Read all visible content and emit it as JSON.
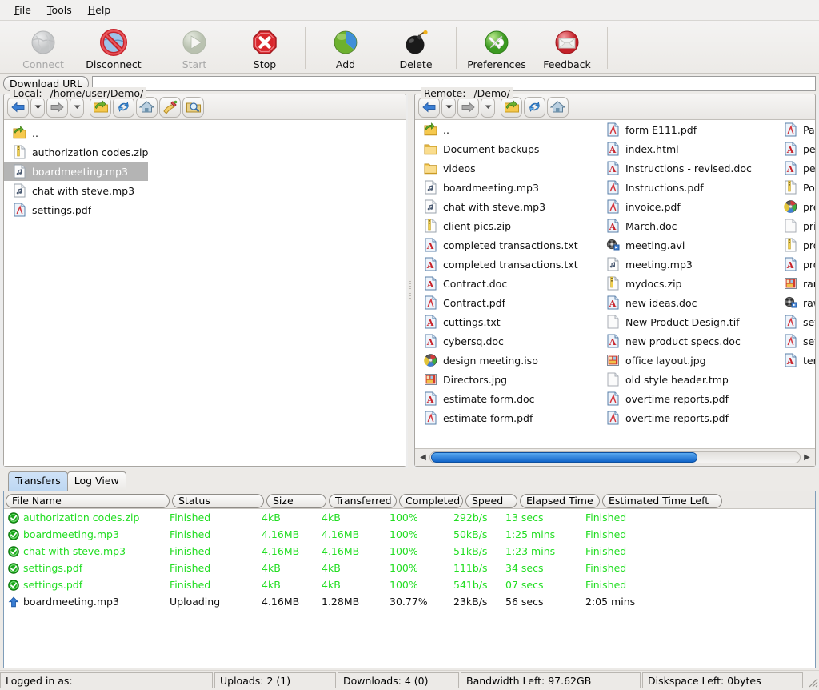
{
  "menubar": {
    "items": [
      {
        "label": "File",
        "mnemonic": "F"
      },
      {
        "label": "Tools",
        "mnemonic": "T"
      },
      {
        "label": "Help",
        "mnemonic": "H"
      }
    ]
  },
  "toolbar": {
    "buttons": [
      {
        "label": "Connect",
        "icon": "globe-icon",
        "enabled": false
      },
      {
        "label": "Disconnect",
        "icon": "no-entry-globe-icon",
        "enabled": true
      },
      {
        "label": "Start",
        "icon": "play-icon",
        "enabled": false
      },
      {
        "label": "Stop",
        "icon": "stop-octagon-icon",
        "enabled": true
      },
      {
        "label": "Add",
        "icon": "add-pie-icon",
        "enabled": true
      },
      {
        "label": "Delete",
        "icon": "bomb-icon",
        "enabled": true
      },
      {
        "label": "Preferences",
        "icon": "tools-gear-icon",
        "enabled": true
      },
      {
        "label": "Feedback",
        "icon": "envelope-icon",
        "enabled": true
      }
    ]
  },
  "download_url": {
    "button_label": "Download URL",
    "value": "",
    "placeholder": ""
  },
  "local_pane": {
    "legend_label": "Local:",
    "path": "/home/user/Demo/",
    "nav_buttons": [
      {
        "name": "back-button",
        "icon": "arrow-left-icon"
      },
      {
        "name": "back-history-button",
        "icon": "chevron-down-icon"
      },
      {
        "name": "forward-button",
        "icon": "arrow-right-icon"
      },
      {
        "name": "forward-history-button",
        "icon": "chevron-down-icon"
      },
      {
        "name": "up-directory-button",
        "icon": "folder-up-icon"
      },
      {
        "name": "refresh-button",
        "icon": "refresh-icon"
      },
      {
        "name": "home-button",
        "icon": "home-icon"
      },
      {
        "name": "cleanup-button",
        "icon": "broom-icon"
      },
      {
        "name": "find-button",
        "icon": "folder-search-icon"
      }
    ],
    "files": [
      {
        "name": "..",
        "icon": "parent-folder-icon",
        "selected": false
      },
      {
        "name": "authorization codes.zip",
        "icon": "zip-icon",
        "selected": false
      },
      {
        "name": "boardmeeting.mp3",
        "icon": "audio-icon",
        "selected": true
      },
      {
        "name": "chat with steve.mp3",
        "icon": "audio-icon",
        "selected": false
      },
      {
        "name": "settings.pdf",
        "icon": "pdf-icon",
        "selected": false
      }
    ]
  },
  "remote_pane": {
    "legend_label": "Remote:",
    "path": "/Demo/",
    "nav_buttons": [
      {
        "name": "back-button",
        "icon": "arrow-left-icon"
      },
      {
        "name": "back-history-button",
        "icon": "chevron-down-icon"
      },
      {
        "name": "forward-button",
        "icon": "arrow-right-icon"
      },
      {
        "name": "forward-history-button",
        "icon": "chevron-down-icon"
      },
      {
        "name": "up-directory-button",
        "icon": "folder-up-icon"
      },
      {
        "name": "refresh-button",
        "icon": "refresh-icon"
      },
      {
        "name": "home-button",
        "icon": "home-icon"
      }
    ],
    "columns": [
      [
        {
          "name": "..",
          "icon": "parent-folder-icon"
        },
        {
          "name": "Document backups",
          "icon": "folder-icon"
        },
        {
          "name": "videos",
          "icon": "folder-icon"
        },
        {
          "name": "boardmeeting.mp3",
          "icon": "audio-icon"
        },
        {
          "name": "chat with steve.mp3",
          "icon": "audio-icon"
        },
        {
          "name": "client pics.zip",
          "icon": "zip-icon"
        },
        {
          "name": "completed transactions.txt",
          "icon": "doc-a-icon"
        },
        {
          "name": "completed transactions.txt",
          "icon": "doc-a-icon"
        },
        {
          "name": "Contract.doc",
          "icon": "doc-a-icon"
        },
        {
          "name": "Contract.pdf",
          "icon": "pdf-icon"
        },
        {
          "name": "cuttings.txt",
          "icon": "doc-a-icon"
        },
        {
          "name": "cybersq.doc",
          "icon": "doc-a-icon"
        },
        {
          "name": "design meeting.iso",
          "icon": "disc-icon"
        },
        {
          "name": "Directors.jpg",
          "icon": "image-icon"
        },
        {
          "name": "estimate form.doc",
          "icon": "doc-a-icon"
        },
        {
          "name": "estimate form.pdf",
          "icon": "pdf-icon"
        }
      ],
      [
        {
          "name": "form E111.pdf",
          "icon": "pdf-icon"
        },
        {
          "name": "index.html",
          "icon": "doc-a-icon"
        },
        {
          "name": "Instructions - revised.doc",
          "icon": "doc-a-icon"
        },
        {
          "name": "Instructions.pdf",
          "icon": "pdf-icon"
        },
        {
          "name": "invoice.pdf",
          "icon": "pdf-icon"
        },
        {
          "name": "March.doc",
          "icon": "doc-a-icon"
        },
        {
          "name": "meeting.avi",
          "icon": "video-icon"
        },
        {
          "name": "meeting.mp3",
          "icon": "audio-icon"
        },
        {
          "name": "mydocs.zip",
          "icon": "zip-icon"
        },
        {
          "name": "new ideas.doc",
          "icon": "doc-a-icon"
        },
        {
          "name": "New Product Design.tif",
          "icon": "blank-doc-icon"
        },
        {
          "name": "new product specs.doc",
          "icon": "doc-a-icon"
        },
        {
          "name": "office layout.jpg",
          "icon": "image-icon"
        },
        {
          "name": "old style header.tmp",
          "icon": "blank-doc-icon"
        },
        {
          "name": "overtime reports.pdf",
          "icon": "pdf-icon"
        },
        {
          "name": "overtime reports.pdf",
          "icon": "pdf-icon"
        }
      ],
      [
        {
          "name": "Paris",
          "icon": "pdf-icon"
        },
        {
          "name": "perfo",
          "icon": "doc-a-icon"
        },
        {
          "name": "petty",
          "icon": "doc-a-icon"
        },
        {
          "name": "Portfo",
          "icon": "zip-icon"
        },
        {
          "name": "prese",
          "icon": "disc-icon"
        },
        {
          "name": "print",
          "icon": "blank-doc-icon"
        },
        {
          "name": "produ",
          "icon": "zip-icon"
        },
        {
          "name": "produ",
          "icon": "doc-a-icon"
        },
        {
          "name": "ramar",
          "icon": "image-icon"
        },
        {
          "name": "raw fe",
          "icon": "video-icon"
        },
        {
          "name": "settin",
          "icon": "pdf-icon"
        },
        {
          "name": "settin",
          "icon": "pdf-icon"
        },
        {
          "name": "terms",
          "icon": "doc-a-icon"
        }
      ]
    ],
    "scrollbar": {
      "thumb_percent": 72
    }
  },
  "bottom": {
    "tabs": [
      {
        "label": "Transfers",
        "active": true
      },
      {
        "label": "Log View",
        "active": false
      }
    ],
    "table": {
      "headers": [
        "File Name",
        "Status",
        "Size",
        "Transferred",
        "Completed",
        "Speed",
        "Elapsed Time",
        "Estimated Time Left"
      ],
      "rows": [
        {
          "icon": "check-circle-icon",
          "state": "done",
          "file_name": "authorization codes.zip",
          "status": "Finished",
          "size": "4kB",
          "transferred": "4kB",
          "completed": "100%",
          "speed": "292b/s",
          "elapsed": "13 secs",
          "eta": "Finished"
        },
        {
          "icon": "check-circle-icon",
          "state": "done",
          "file_name": "boardmeeting.mp3",
          "status": "Finished",
          "size": "4.16MB",
          "transferred": "4.16MB",
          "completed": "100%",
          "speed": "50kB/s",
          "elapsed": "1:25 mins",
          "eta": "Finished"
        },
        {
          "icon": "check-circle-icon",
          "state": "done",
          "file_name": "chat with steve.mp3",
          "status": "Finished",
          "size": "4.16MB",
          "transferred": "4.16MB",
          "completed": "100%",
          "speed": "51kB/s",
          "elapsed": "1:23 mins",
          "eta": "Finished"
        },
        {
          "icon": "check-circle-icon",
          "state": "done",
          "file_name": "settings.pdf",
          "status": "Finished",
          "size": "4kB",
          "transferred": "4kB",
          "completed": "100%",
          "speed": "111b/s",
          "elapsed": "34 secs",
          "eta": "Finished"
        },
        {
          "icon": "check-circle-icon",
          "state": "done",
          "file_name": "settings.pdf",
          "status": "Finished",
          "size": "4kB",
          "transferred": "4kB",
          "completed": "100%",
          "speed": "541b/s",
          "elapsed": "07 secs",
          "eta": "Finished"
        },
        {
          "icon": "upload-arrow-icon",
          "state": "active",
          "file_name": "boardmeeting.mp3",
          "status": "Uploading",
          "size": "4.16MB",
          "transferred": "1.28MB",
          "completed": "30.77%",
          "speed": "23kB/s",
          "elapsed": "56 secs",
          "eta": "2:05 mins"
        }
      ]
    }
  },
  "statusbar": {
    "logged_in": "Logged in as:",
    "uploads": "Uploads: 2 (1)",
    "downloads": "Downloads: 4 (0)",
    "bandwidth": "Bandwidth Left: 97.62GB",
    "diskspace": "Diskspace Left: 0bytes"
  },
  "colors": {
    "finished_green": "#22dd22",
    "selection_gray": "#b4b4b4",
    "active_tab_blue": "#bdd7f2",
    "scrollbar_blue": "#1164c8"
  }
}
